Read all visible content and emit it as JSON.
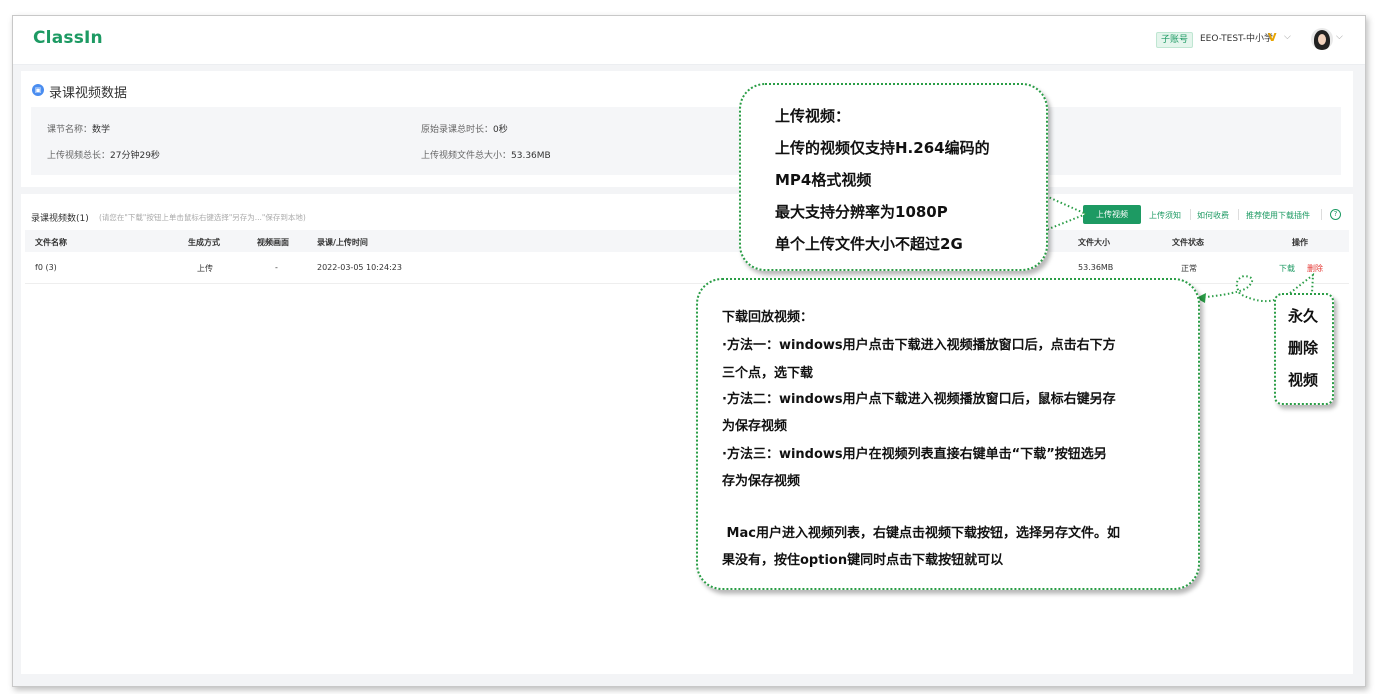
{
  "header": {
    "logo": "ClassIn",
    "sub_account_badge": "子账号",
    "account_name": "EEO-TEST-中小学",
    "vip_mark": "V",
    "caret": "⌵"
  },
  "info_card": {
    "title": "录课视频数据",
    "lesson_name_label": "课节名称：",
    "lesson_name_value": "数学",
    "original_duration_label": "原始录课总时长：",
    "original_duration_value": "0秒",
    "upload_duration_label": "上传视频总长：",
    "upload_duration_value": "27分钟29秒",
    "upload_size_label": "上传视频文件总大小：",
    "upload_size_value": "53.36MB"
  },
  "list": {
    "title": "录课视频数(1)",
    "hint": "(请您在\"下载\"按钮上单击鼠标右键选择\"另存为...\"保存到本地)",
    "upload_button": "上传视频",
    "links": [
      "上传须知",
      "如何收费",
      "推荐使用下载插件"
    ],
    "help_icon": "?",
    "columns": {
      "name": "文件名称",
      "method": "生成方式",
      "picture": "视频画面",
      "time": "录课/上传时间",
      "size": "文件大小",
      "status": "文件状态",
      "ops": "操作"
    },
    "rows": [
      {
        "name": "f0 (3)",
        "method": "上传",
        "picture": "-",
        "time": "2022-03-05 10:24:23",
        "size": "53.36MB",
        "status": "正常",
        "download": "下载",
        "delete": "删除"
      }
    ]
  },
  "callouts": {
    "upload_tip": [
      "上传视频：",
      "上传的视频仅支持H.264编码的",
      "MP4格式视频",
      "最大支持分辨率为1080P",
      "单个上传文件大小不超过2G"
    ],
    "download_tip": [
      "下载回放视频：",
      "·方法一：windows用户点击下载进入视频播放窗口后，点击右下方",
      "三个点，选下载",
      "·方法二：windows用户点下载进入视频播放窗口后，鼠标右键另存",
      "为保存视频",
      "·方法三：windows用户在视频列表直接右键单击“下载”按钮选另",
      "存为保存视频",
      " Mac用户进入视频列表，右键点击视频下载按钮，选择另存文件。如",
      "果没有，按住option键同时点击下载按钮就可以"
    ],
    "delete_tip": [
      "永久",
      "删除",
      "视频"
    ]
  },
  "colors": {
    "brand": "#1d9a63",
    "delete": "#e53935",
    "callout_border": "#2a9d46"
  }
}
